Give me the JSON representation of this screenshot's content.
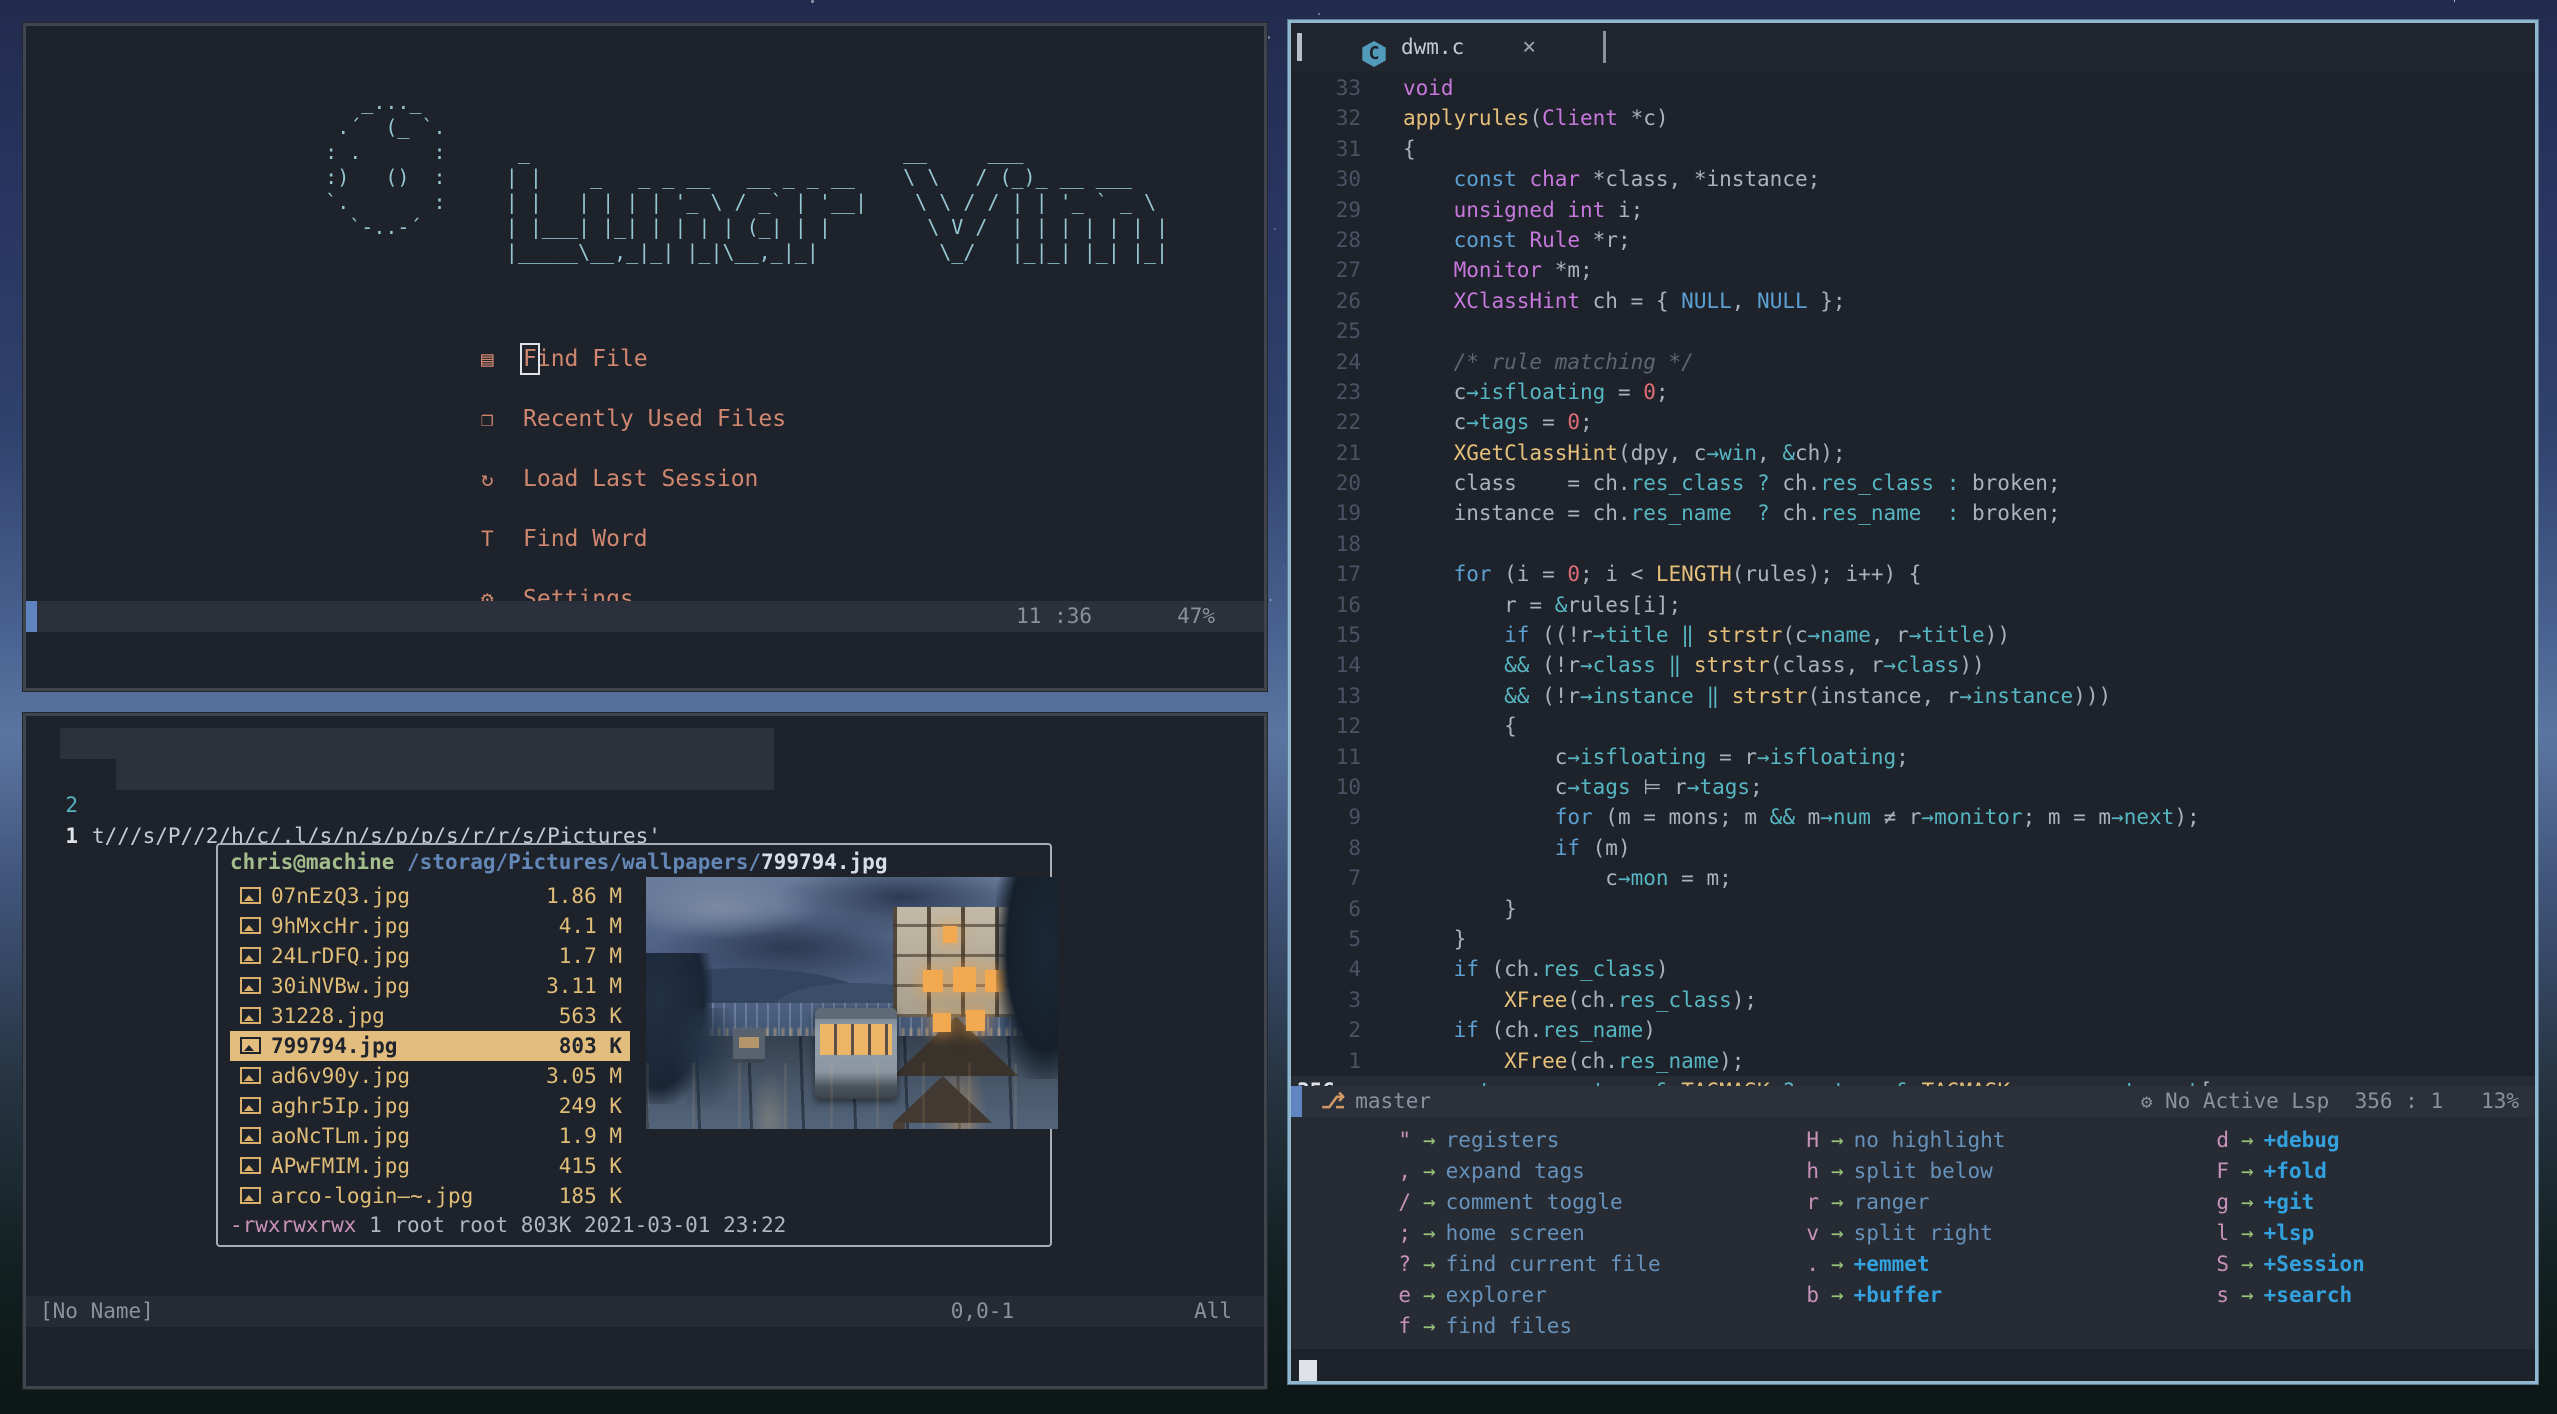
{
  "lunarvim": {
    "logo": [
      "       _..._",
      "     .´  (_ `.",
      "    : .      :      _                               __     ___",
      "    :)   ()  :     | |    _   _ _ __   __ _ _ __    \\ \\   / (_)_ __ ___",
      "    `.       :     | |   | | | | '_ \\ / _` | '__|    \\ \\ / / | | '_ ` _ \\",
      "      `-..-´       | |___| |_| | | | | (_| | |        \\ V /  | | | | | | |",
      "                   |_____\\__,_|_| |_|\\__,_|_|          \\_/   |_|_| |_| |_|"
    ],
    "menu": [
      {
        "icon": "▤",
        "label": "Find File",
        "cursor": true
      },
      {
        "icon": "❐",
        "label": "Recently Used Files"
      },
      {
        "icon": "↻",
        "label": "Load Last Session"
      },
      {
        "icon": "T",
        "label": "Find Word"
      },
      {
        "icon": "⚙",
        "label": "Settings"
      }
    ],
    "statusline": {
      "pos": "11 :36",
      "pct": "47%"
    }
  },
  "scratch": {
    "lines": [
      {
        "n": "2",
        "text": "t///s/P//2/h/c/.l/s/n/s/p/p/s/r/r/s/Pictures'"
      },
      {
        "n": "1",
        "text": ""
      }
    ],
    "float": {
      "title": {
        "user": "chris@machine",
        "path": " /storag/Pictures/wallpapers/",
        "file": "799794.jpg"
      },
      "files": [
        {
          "name": "07nEzQ3.jpg",
          "size": "1.86 M"
        },
        {
          "name": "9hMxcHr.jpg",
          "size": "4.1 M"
        },
        {
          "name": "24LrDFQ.jpg",
          "size": "1.7 M"
        },
        {
          "name": "30iNVBw.jpg",
          "size": "3.11 M"
        },
        {
          "name": "31228.jpg",
          "size": "563 K"
        },
        {
          "name": "799794.jpg",
          "size": "803 K",
          "selected": true
        },
        {
          "name": "ad6v90y.jpg",
          "size": "3.05 M"
        },
        {
          "name": "aghr5Ip.jpg",
          "size": "249 K"
        },
        {
          "name": "aoNcTLm.jpg",
          "size": "1.9 M"
        },
        {
          "name": "APwFMIM.jpg",
          "size": "415 K"
        },
        {
          "name": "arco-login—~.jpg",
          "size": "185 K"
        }
      ],
      "info": {
        "perms": "-rwxrwxrwx",
        "meta": " 1 root root 803K 2021-03-01 23:22"
      }
    },
    "statusline": {
      "name": "[No Name]",
      "cursor": "0,0-1",
      "scroll": "All"
    }
  },
  "editor": {
    "tab": {
      "icon": "C",
      "label": "dwm.c",
      "close": "×"
    },
    "lines": [
      {
        "n": "33",
        "s": [
          [
            "y",
            "void"
          ]
        ]
      },
      {
        "n": "32",
        "s": [
          [
            "f",
            "applyrules"
          ],
          [
            "t",
            "("
          ],
          [
            "y",
            "Client"
          ],
          [
            "t",
            " *c)"
          ]
        ]
      },
      {
        "n": "31",
        "s": [
          [
            "t",
            "{"
          ]
        ]
      },
      {
        "n": "30",
        "s": [
          [
            "t",
            "    "
          ],
          [
            "k",
            "const"
          ],
          [
            "t",
            " "
          ],
          [
            "y",
            "char"
          ],
          [
            "t",
            " *class, *instance;"
          ]
        ]
      },
      {
        "n": "29",
        "s": [
          [
            "t",
            "    "
          ],
          [
            "y",
            "unsigned"
          ],
          [
            "t",
            " "
          ],
          [
            "y",
            "int"
          ],
          [
            "t",
            " i;"
          ]
        ]
      },
      {
        "n": "28",
        "s": [
          [
            "t",
            "    "
          ],
          [
            "k",
            "const"
          ],
          [
            "t",
            " "
          ],
          [
            "y",
            "Rule"
          ],
          [
            "t",
            " *r;"
          ]
        ]
      },
      {
        "n": "27",
        "s": [
          [
            "t",
            "    "
          ],
          [
            "y",
            "Monitor"
          ],
          [
            "t",
            " *m;"
          ]
        ]
      },
      {
        "n": "26",
        "s": [
          [
            "t",
            "    "
          ],
          [
            "y",
            "XClassHint"
          ],
          [
            "t",
            " ch = { "
          ],
          [
            "k",
            "NULL"
          ],
          [
            "t",
            ", "
          ],
          [
            "k",
            "NULL"
          ],
          [
            "t",
            " };"
          ]
        ]
      },
      {
        "n": "25",
        "s": []
      },
      {
        "n": "24",
        "s": [
          [
            "t",
            "    "
          ],
          [
            "c",
            "/* rule matching */"
          ]
        ]
      },
      {
        "n": "23",
        "s": [
          [
            "t",
            "    c"
          ],
          [
            "m",
            "→isfloating"
          ],
          [
            "t",
            " = "
          ],
          [
            "n",
            "0"
          ],
          [
            "t",
            ";"
          ]
        ]
      },
      {
        "n": "22",
        "s": [
          [
            "t",
            "    c"
          ],
          [
            "m",
            "→tags"
          ],
          [
            "t",
            " = "
          ],
          [
            "n",
            "0"
          ],
          [
            "t",
            ";"
          ]
        ]
      },
      {
        "n": "21",
        "s": [
          [
            "t",
            "    "
          ],
          [
            "f",
            "XGetClassHint"
          ],
          [
            "t",
            "(dpy, c"
          ],
          [
            "m",
            "→win"
          ],
          [
            "t",
            ", "
          ],
          [
            "o",
            "&"
          ],
          [
            "t",
            "ch);"
          ]
        ]
      },
      {
        "n": "20",
        "s": [
          [
            "t",
            "    class    = ch."
          ],
          [
            "m",
            "res_class"
          ],
          [
            "t",
            " "
          ],
          [
            "o",
            "?"
          ],
          [
            "t",
            " ch."
          ],
          [
            "m",
            "res_class"
          ],
          [
            "t",
            " "
          ],
          [
            "o",
            ":"
          ],
          [
            "t",
            " broken;"
          ]
        ]
      },
      {
        "n": "19",
        "s": [
          [
            "t",
            "    instance = ch."
          ],
          [
            "m",
            "res_name"
          ],
          [
            "t",
            "  "
          ],
          [
            "o",
            "?"
          ],
          [
            "t",
            " ch."
          ],
          [
            "m",
            "res_name"
          ],
          [
            "t",
            "  "
          ],
          [
            "o",
            ":"
          ],
          [
            "t",
            " broken;"
          ]
        ]
      },
      {
        "n": "18",
        "s": []
      },
      {
        "n": "17",
        "s": [
          [
            "t",
            "    "
          ],
          [
            "k",
            "for"
          ],
          [
            "t",
            " (i = "
          ],
          [
            "n",
            "0"
          ],
          [
            "t",
            "; i < "
          ],
          [
            "f",
            "LENGTH"
          ],
          [
            "t",
            "(rules); i++) {"
          ]
        ]
      },
      {
        "n": "16",
        "s": [
          [
            "t",
            "        r = "
          ],
          [
            "o",
            "&"
          ],
          [
            "t",
            "rules[i];"
          ]
        ]
      },
      {
        "n": "15",
        "s": [
          [
            "t",
            "        "
          ],
          [
            "k",
            "if"
          ],
          [
            "t",
            " ((!r"
          ],
          [
            "m",
            "→title"
          ],
          [
            "t",
            " "
          ],
          [
            "o",
            "‖"
          ],
          [
            "t",
            " "
          ],
          [
            "f",
            "strstr"
          ],
          [
            "t",
            "(c"
          ],
          [
            "m",
            "→name"
          ],
          [
            "t",
            ", r"
          ],
          [
            "m",
            "→title"
          ],
          [
            "t",
            "))"
          ]
        ]
      },
      {
        "n": "14",
        "s": [
          [
            "t",
            "        "
          ],
          [
            "o",
            "&&"
          ],
          [
            "t",
            " (!r"
          ],
          [
            "m",
            "→class"
          ],
          [
            "t",
            " "
          ],
          [
            "o",
            "‖"
          ],
          [
            "t",
            " "
          ],
          [
            "f",
            "strstr"
          ],
          [
            "t",
            "(class, r"
          ],
          [
            "m",
            "→class"
          ],
          [
            "t",
            "))"
          ]
        ]
      },
      {
        "n": "13",
        "s": [
          [
            "t",
            "        "
          ],
          [
            "o",
            "&&"
          ],
          [
            "t",
            " (!r"
          ],
          [
            "m",
            "→instance"
          ],
          [
            "t",
            " "
          ],
          [
            "o",
            "‖"
          ],
          [
            "t",
            " "
          ],
          [
            "f",
            "strstr"
          ],
          [
            "t",
            "(instance, r"
          ],
          [
            "m",
            "→instance"
          ],
          [
            "t",
            ")))"
          ]
        ]
      },
      {
        "n": "12",
        "s": [
          [
            "t",
            "        {"
          ]
        ]
      },
      {
        "n": "11",
        "s": [
          [
            "t",
            "            c"
          ],
          [
            "m",
            "→isfloating"
          ],
          [
            "t",
            " = r"
          ],
          [
            "m",
            "→isfloating"
          ],
          [
            "t",
            ";"
          ]
        ]
      },
      {
        "n": "10",
        "s": [
          [
            "t",
            "            c"
          ],
          [
            "m",
            "→tags"
          ],
          [
            "t",
            " ⊨ r"
          ],
          [
            "m",
            "→tags"
          ],
          [
            "t",
            ";"
          ]
        ]
      },
      {
        "n": "9",
        "s": [
          [
            "t",
            "            "
          ],
          [
            "k",
            "for"
          ],
          [
            "t",
            " (m = mons; m "
          ],
          [
            "o",
            "&&"
          ],
          [
            "t",
            " m"
          ],
          [
            "m",
            "→num"
          ],
          [
            "t",
            " ≠ r"
          ],
          [
            "m",
            "→monitor"
          ],
          [
            "t",
            "; m = m"
          ],
          [
            "m",
            "→next"
          ],
          [
            "t",
            ");"
          ]
        ]
      },
      {
        "n": "8",
        "s": [
          [
            "t",
            "            "
          ],
          [
            "k",
            "if"
          ],
          [
            "t",
            " (m)"
          ]
        ]
      },
      {
        "n": "7",
        "s": [
          [
            "t",
            "                c"
          ],
          [
            "m",
            "→mon"
          ],
          [
            "t",
            " = m;"
          ]
        ]
      },
      {
        "n": "6",
        "s": [
          [
            "t",
            "        }"
          ]
        ]
      },
      {
        "n": "5",
        "s": [
          [
            "t",
            "    }"
          ]
        ]
      },
      {
        "n": "4",
        "s": [
          [
            "t",
            "    "
          ],
          [
            "k",
            "if"
          ],
          [
            "t",
            " (ch."
          ],
          [
            "m",
            "res_class"
          ],
          [
            "t",
            ")"
          ]
        ]
      },
      {
        "n": "3",
        "s": [
          [
            "t",
            "        "
          ],
          [
            "f",
            "XFree"
          ],
          [
            "t",
            "(ch."
          ],
          [
            "m",
            "res_class"
          ],
          [
            "t",
            ");"
          ]
        ]
      },
      {
        "n": "2",
        "s": [
          [
            "t",
            "    "
          ],
          [
            "k",
            "if"
          ],
          [
            "t",
            " (ch."
          ],
          [
            "m",
            "res_name"
          ],
          [
            "t",
            ")"
          ]
        ]
      },
      {
        "n": "1",
        "s": [
          [
            "t",
            "        "
          ],
          [
            "f",
            "XFree"
          ],
          [
            "t",
            "(ch."
          ],
          [
            "m",
            "res_name"
          ],
          [
            "t",
            ");"
          ]
        ]
      },
      {
        "n": "356",
        "current": true,
        "s": [
          [
            "t",
            "    c"
          ],
          [
            "m",
            "→tags"
          ],
          [
            "t",
            " = c"
          ],
          [
            "m",
            "→tags"
          ],
          [
            "t",
            " "
          ],
          [
            "o",
            "&"
          ],
          [
            "t",
            " "
          ],
          [
            "f",
            "TAGMASK"
          ],
          [
            "t",
            " "
          ],
          [
            "o",
            "?"
          ],
          [
            "t",
            " c"
          ],
          [
            "m",
            "→tags"
          ],
          [
            "t",
            " "
          ],
          [
            "o",
            "&"
          ],
          [
            "t",
            " "
          ],
          [
            "f",
            "TAGMASK"
          ],
          [
            "t",
            " "
          ],
          [
            "o",
            ":"
          ],
          [
            "t",
            " c"
          ],
          [
            "m",
            "→mon"
          ],
          [
            "m",
            "→tagset"
          ],
          [
            "t",
            "[c"
          ],
          [
            "m",
            "→mon"
          ]
        ]
      }
    ],
    "statusbar": {
      "branch_icon": "⎇",
      "branch": "master",
      "lsp_icon": "⚙",
      "lsp": "No Active Lsp",
      "loc": "356 : 1",
      "pct": "13%"
    },
    "whichkey": {
      "cols": [
        [
          {
            "key": "\"",
            "desc": "registers"
          },
          {
            "key": ",",
            "desc": "expand tags"
          },
          {
            "key": "/",
            "desc": "comment toggle"
          },
          {
            "key": ";",
            "desc": "home screen"
          },
          {
            "key": "?",
            "desc": "find current file"
          },
          {
            "key": "e",
            "desc": "explorer"
          },
          {
            "key": "f",
            "desc": "find files"
          }
        ],
        [
          {
            "key": "H",
            "desc": "no highlight"
          },
          {
            "key": "h",
            "desc": "split below"
          },
          {
            "key": "r",
            "desc": "ranger"
          },
          {
            "key": "v",
            "desc": "split right"
          },
          {
            "key": ".",
            "desc": "+emmet",
            "group": true
          },
          {
            "key": "b",
            "desc": "+buffer",
            "group": true
          }
        ],
        [
          {
            "key": "d",
            "desc": "+debug",
            "group": true
          },
          {
            "key": "F",
            "desc": "+fold",
            "group": true
          },
          {
            "key": "g",
            "desc": "+git",
            "group": true
          },
          {
            "key": "l",
            "desc": "+lsp",
            "group": true
          },
          {
            "key": "S",
            "desc": "+Session",
            "group": true
          },
          {
            "key": "s",
            "desc": "+search",
            "group": true
          }
        ]
      ]
    }
  },
  "colors": {
    "accent_blue": "#5f84c0",
    "focus_border": "#8fb8d0",
    "select_bg": "#e3bd7e",
    "menu_salmon": "#d08770",
    "logo_cyan": "#93c7d3"
  }
}
